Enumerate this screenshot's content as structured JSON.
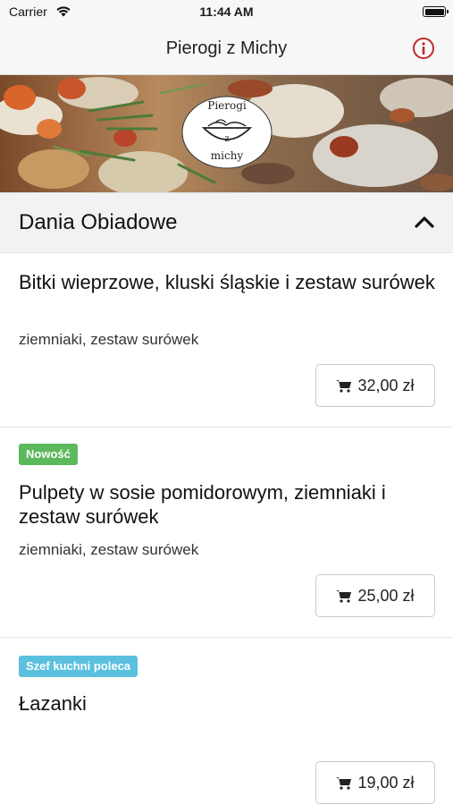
{
  "status_bar": {
    "carrier": "Carrier",
    "time": "11:44 AM"
  },
  "navbar": {
    "title": "Pierogi z Michy"
  },
  "logo": {
    "lines": [
      "Pierogi",
      "z",
      "michy"
    ]
  },
  "section": {
    "title": "Dania Obiadowe"
  },
  "colors": {
    "new_badge": "#5cb85c",
    "chef_badge": "#5bc0de",
    "info_icon": "#c0282d"
  },
  "items": [
    {
      "name": "Bitki wieprzowe, kluski śląskie i zestaw surówek",
      "description": "ziemniaki, zestaw surówek",
      "price": "32,00 zł"
    },
    {
      "badge": "Nowość",
      "name": "Pulpety w sosie pomidorowym, ziemniaki i zestaw surówek",
      "description": "ziemniaki, zestaw surówek",
      "price": "25,00 zł"
    },
    {
      "badge": "Szef kuchni poleca",
      "name": "Łazanki",
      "price": "19,00 zł"
    }
  ]
}
